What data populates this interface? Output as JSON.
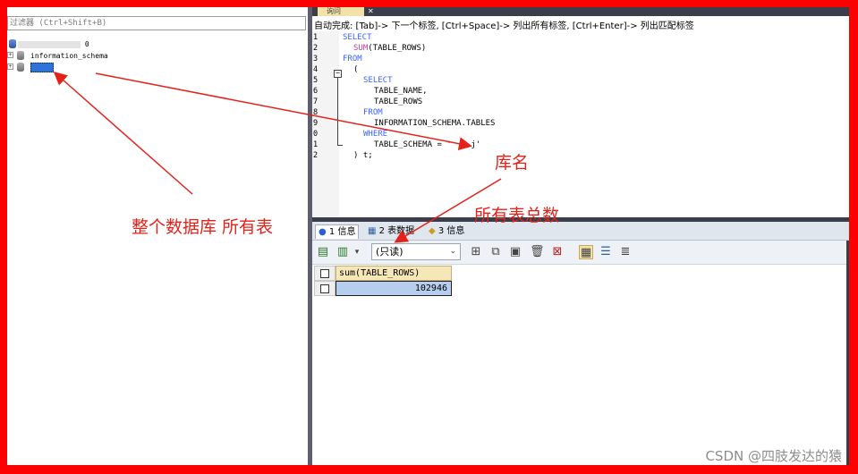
{
  "left_panel": {
    "filter_placeholder": "过滤器 (Ctrl+Shift+B)",
    "tree": [
      {
        "label": "0",
        "redacted": true
      },
      {
        "label": "information_schema"
      },
      {
        "label": "",
        "selected": true
      }
    ]
  },
  "editor": {
    "tab_label": "询问",
    "autocomplete_hint": "自动完成: [Tab]-> 下一个标签, [Ctrl+Space]-> 列出所有标签, [Ctrl+Enter]-> 列出匹配标签",
    "line_numbers": [
      "1",
      "2",
      "3",
      "4",
      "5",
      "6",
      "7",
      "8",
      "9",
      "0",
      "1",
      "2"
    ],
    "lines": [
      {
        "kw": "SELECT",
        "text": ""
      },
      {
        "fn": "SUM",
        "text": "(TABLE_ROWS)"
      },
      {
        "kw": "FROM",
        "text": ""
      },
      {
        "text": "("
      },
      {
        "kw": "SELECT",
        "text": ""
      },
      {
        "text": "TABLE_NAME,"
      },
      {
        "text": "TABLE_ROWS"
      },
      {
        "kw": "FROM",
        "text": ""
      },
      {
        "text": "INFORMATION_SCHEMA.TABLES"
      },
      {
        "kw": "WHERE",
        "text": ""
      },
      {
        "text": "TABLE_SCHEMA = '    j'"
      },
      {
        "text": ") t;"
      }
    ]
  },
  "results": {
    "tabs": [
      {
        "label": "1 信息",
        "icon": "info-icon"
      },
      {
        "label": "2 表数据",
        "icon": "table-icon"
      },
      {
        "label": "3 信息",
        "icon": "info-icon"
      }
    ],
    "mode_select": "(只读)",
    "column_header": "sum(TABLE_ROWS)",
    "value": "102946"
  },
  "annotations": {
    "whole_db": "整个数据库 所有表",
    "db_name": "库名",
    "total_rows": "所有表总数"
  },
  "watermark": "CSDN @四肢发达的猿",
  "colors": {
    "border": "#ff0000",
    "annotation": "#e4211b",
    "keyword": "#3b63ff",
    "function": "#c03aa8",
    "selection": "#2e73d8"
  }
}
